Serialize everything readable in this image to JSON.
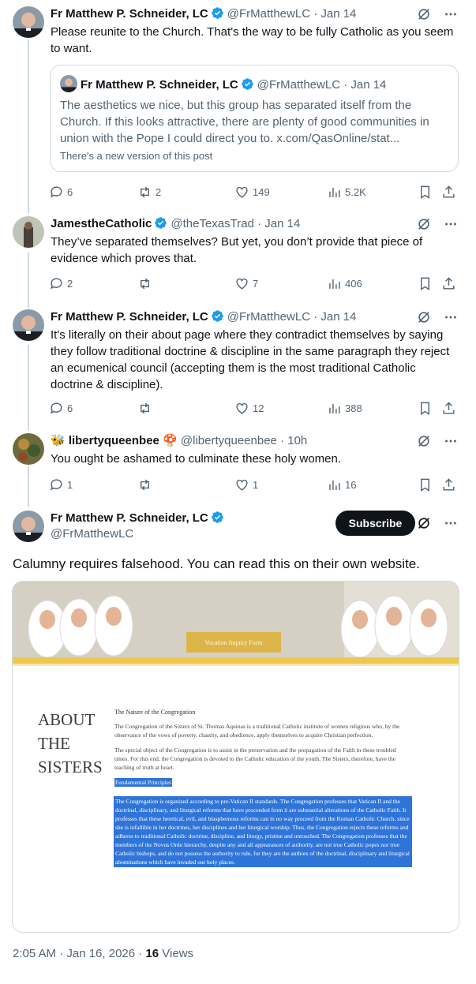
{
  "colors": {
    "blue_check": "#1d9bf0",
    "text": "#0f1419",
    "muted": "#536471",
    "highlight": "#2f74d8"
  },
  "tweets": [
    {
      "name": "Fr Matthew P. Schneider, LC",
      "handle": "@FrMatthewLC",
      "date": "· Jan 14",
      "text": "Please reunite to the Church. That's the way to be fully Catholic as you seem to want.",
      "quote": {
        "name": "Fr Matthew P. Schneider, LC",
        "handle": "@FrMatthewLC",
        "date": "· Jan 14",
        "text": "The aesthetics we nice, but this group has separated itself from the Church. If this looks attractive, there are plenty of good communities in union with the Pope I could direct you to. x.com/QasOnline/stat...",
        "note": "There's a new version of this post"
      },
      "replies": "6",
      "reposts": "2",
      "likes": "149",
      "views": "5.2K"
    },
    {
      "name": "JamestheCatholic",
      "handle": "@theTexasTrad",
      "date": "· Jan 14",
      "text": "They’ve separated themselves? But yet, you don’t provide that piece of evidence which proves that.",
      "replies": "2",
      "reposts": "",
      "likes": "7",
      "views": "406"
    },
    {
      "name": "Fr Matthew P. Schneider, LC",
      "handle": "@FrMatthewLC",
      "date": "· Jan 14",
      "text": "It's literally on their about page where they contradict themselves by saying they follow traditional doctrine & discipline in the same paragraph they reject an ecumenical council (accepting them is the most traditional Catholic doctrine & discipline).",
      "replies": "6",
      "reposts": "",
      "likes": "12",
      "views": "388"
    },
    {
      "name": "🐝 libertyqueenbee 🍄",
      "handle": "@libertyqueenbee",
      "date": "· 10h",
      "text": "You ought be ashamed to culminate these holy women.",
      "replies": "1",
      "reposts": "",
      "likes": "1",
      "views": "16"
    }
  ],
  "main": {
    "name": "Fr Matthew P. Schneider, LC",
    "handle": "@FrMatthewLC",
    "subscribe_label": "Subscribe",
    "text": "Calumny requires falsehood. You can read this on their own website.",
    "image": {
      "vocation_button": "Vocation Inquiry Form",
      "about_line1": "ABOUT",
      "about_line2": "THE",
      "about_line3": "SISTERS",
      "heading": "The Nature of the Congregation",
      "para1": "The Congregation of the Sisters of St. Thomas Aquinas is a traditional Catholic institute of women religious who, by the observance of the vows of poverty, chastity, and obedience, apply themselves to acquire Christian perfection.",
      "para2": "The special object of the Congregation is to assist in the preservation and the propagation of the Faith in these troubled times. For this end, the Congregation is devoted to the Catholic education of the youth. The Sisters, therefore, have the teaching of truth at heart.",
      "principles_title": "Fundamental Principles",
      "principles_text": "The Congregation is organized according to pre-Vatican II standards. The Congregation professes that Vatican II and the doctrinal, disciplinary, and liturgical reforms that have proceeded from it are substantial alterations of the Catholic Faith. It professes that these heretical, evil, and blasphemous reforms can in no way proceed from the Roman Catholic Church, since she is infallible in her doctrines, her disciplines and her liturgical worship. Thus, the Congregation rejects these reforms and adheres to traditional Catholic doctrine, discipline, and liturgy, pristine and untouched. The Congregation professes that the members of the Novus Ordo hierarchy, despite any and all appearances of authority, are not true Catholic popes nor true Catholic bishops, and do not possess the authority to rule, for they are the authors of the doctrinal, disciplinary and liturgical abominations which have invaded our holy places."
    },
    "timestamp": "2:05 AM · Jan 16, 2026 · ",
    "views_count": "16",
    "views_label": " Views"
  }
}
